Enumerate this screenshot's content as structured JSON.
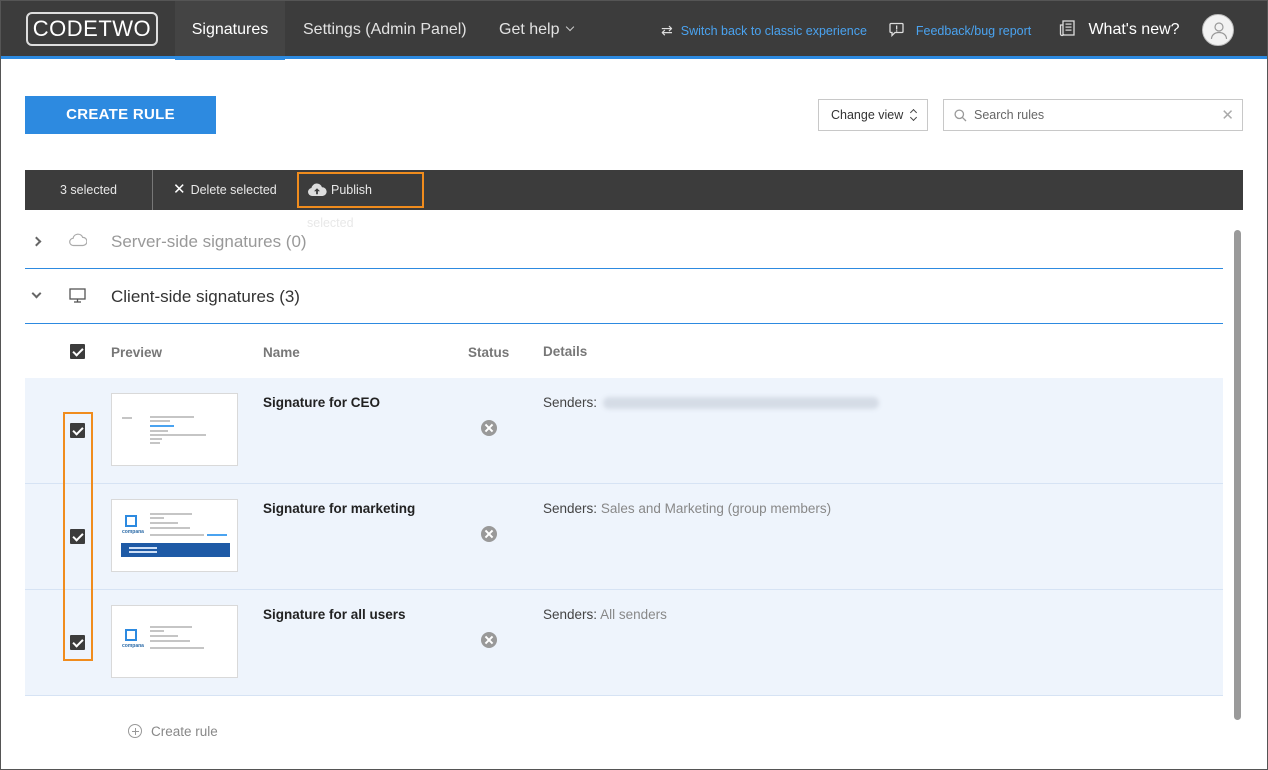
{
  "app": {
    "logo": "CODETWO",
    "tabs": [
      {
        "label": "Signatures",
        "active": true
      },
      {
        "label": "Settings (Admin Panel)",
        "active": false
      },
      {
        "label": "Get help",
        "active": false
      }
    ],
    "links": {
      "classic": "Switch back to classic experience",
      "feedback": "Feedback/bug report",
      "whats_new": "What's new?"
    },
    "accent": "#2d8ae0",
    "highlight": "#f08c1d"
  },
  "toolbar": {
    "create_rule": "CREATE RULE",
    "change_view": "Change view",
    "search_placeholder": "Search rules"
  },
  "selection_bar": {
    "count": "3 selected",
    "delete": "Delete selected",
    "publish": "Publish selected"
  },
  "sections": {
    "server": {
      "title": "Server-side signatures (0)",
      "icon": "cloud-icon"
    },
    "client": {
      "title": "Client-side signatures (3)",
      "icon": "monitor-icon"
    }
  },
  "table": {
    "columns": [
      "Preview",
      "Name",
      "Status",
      "Details"
    ],
    "rows": [
      {
        "name": "Signature for CEO",
        "details_label": "Senders:",
        "details_value": "",
        "checked": true
      },
      {
        "name": "Signature for marketing",
        "details_label": "Senders:",
        "details_value": "Sales and Marketing (group members)",
        "checked": true
      },
      {
        "name": "Signature for all users",
        "details_label": "Senders:",
        "details_value": "All senders",
        "checked": true
      }
    ]
  },
  "footer": {
    "create_rule_link": "Create rule"
  }
}
